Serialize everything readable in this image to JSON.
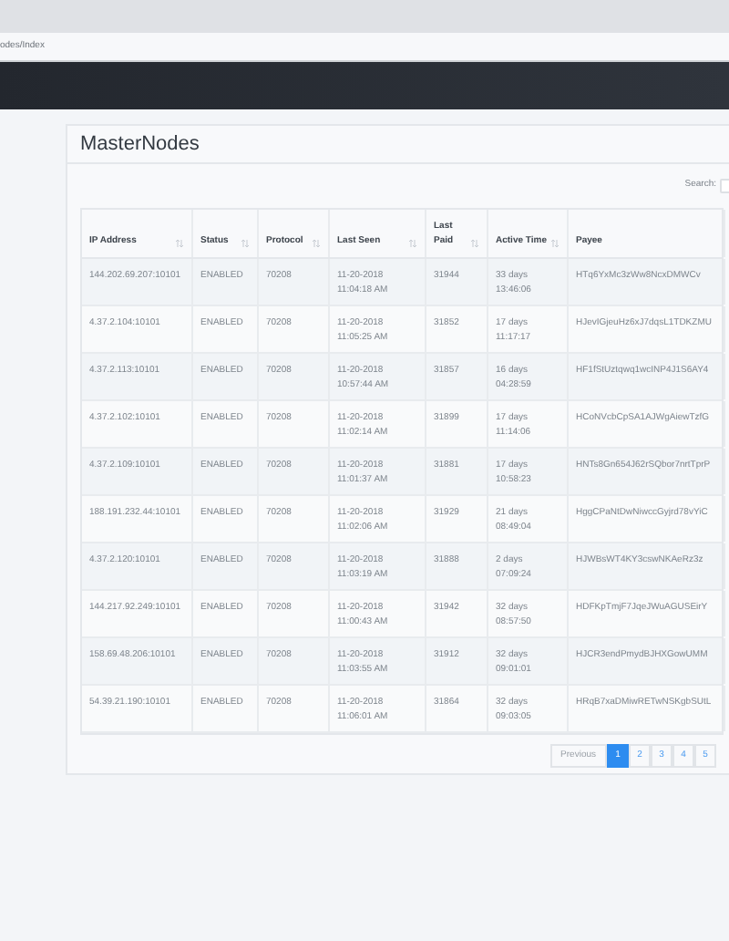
{
  "breadcrumb": "odes/Index",
  "card": {
    "title": "MasterNodes",
    "search_label": "Search:"
  },
  "table": {
    "columns": [
      {
        "label": "IP Address",
        "sortable": true
      },
      {
        "label": "Status",
        "sortable": true
      },
      {
        "label": "Protocol",
        "sortable": true
      },
      {
        "label": "Last Seen",
        "sortable": true
      },
      {
        "label": "Last Paid",
        "sortable": true
      },
      {
        "label": "Active Time",
        "sortable": true
      },
      {
        "label": "Payee",
        "sortable": false
      }
    ],
    "rows": [
      [
        "144.202.69.207:10101",
        "ENABLED",
        "70208",
        "11-20-2018 11:04:18 AM",
        "31944",
        "33 days 13:46:06",
        "HTq6YxMc3zWw8NcxDMWCv"
      ],
      [
        "4.37.2.104:10101",
        "ENABLED",
        "70208",
        "11-20-2018 11:05:25 AM",
        "31852",
        "17 days 11:17:17",
        "HJevIGjeuHz6xJ7dqsL1TDKZMU"
      ],
      [
        "4.37.2.113:10101",
        "ENABLED",
        "70208",
        "11-20-2018 10:57:44 AM",
        "31857",
        "16 days 04:28:59",
        "HF1fStUztqwq1wcINP4J1S6AY4"
      ],
      [
        "4.37.2.102:10101",
        "ENABLED",
        "70208",
        "11-20-2018 11:02:14 AM",
        "31899",
        "17 days 11:14:06",
        "HCoNVcbCpSA1AJWgAiewTzfG"
      ],
      [
        "4.37.2.109:10101",
        "ENABLED",
        "70208",
        "11-20-2018 11:01:37 AM",
        "31881",
        "17 days 10:58:23",
        "HNTs8Gn654J62rSQbor7nrtTprP"
      ],
      [
        "188.191.232.44:10101",
        "ENABLED",
        "70208",
        "11-20-2018 11:02:06 AM",
        "31929",
        "21 days 08:49:04",
        "HggCPaNtDwNiwccGyjrd78vYiC"
      ],
      [
        "4.37.2.120:10101",
        "ENABLED",
        "70208",
        "11-20-2018 11:03:19 AM",
        "31888",
        "2 days 07:09:24",
        "HJWBsWT4KY3cswNKAeRz3z"
      ],
      [
        "144.217.92.249:10101",
        "ENABLED",
        "70208",
        "11-20-2018 11:00:43 AM",
        "31942",
        "32 days 08:57:50",
        "HDFKpTmjF7JqeJWuAGUSEirY"
      ],
      [
        "158.69.48.206:10101",
        "ENABLED",
        "70208",
        "11-20-2018 11:03:55 AM",
        "31912",
        "32 days 09:01:01",
        "HJCR3endPmydBJHXGowUMM"
      ],
      [
        "54.39.21.190:10101",
        "ENABLED",
        "70208",
        "11-20-2018 11:06:01 AM",
        "31864",
        "32 days 09:03:05",
        "HRqB7xaDMiwRETwNSKgbSUtL"
      ]
    ]
  },
  "pagination": {
    "previous": "Previous",
    "pages": [
      {
        "label": "1",
        "selected": true
      },
      {
        "label": "2",
        "selected": false
      },
      {
        "label": "3",
        "selected": false
      },
      {
        "label": "4",
        "selected": false
      },
      {
        "label": "5",
        "selected": false
      }
    ]
  }
}
